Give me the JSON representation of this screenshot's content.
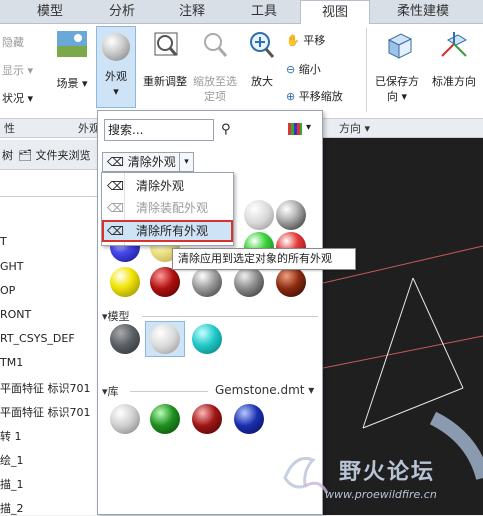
{
  "tabs": [
    "模型",
    "分析",
    "注释",
    "工具",
    "视图",
    "柔性建模"
  ],
  "active_tab": "视图",
  "ribbon": {
    "hide": "隐藏",
    "display": "显示",
    "status": "状况",
    "scene": "场景",
    "appearance": "外观",
    "regen": "重新调整",
    "zoom_selected": "缩放至选定项",
    "zoom_in": "放大",
    "pan": "平移",
    "zoom_out": "缩小",
    "pan_zoom": "平移缩放",
    "saved_orient": "已保存方向",
    "std_orient": "标准方向",
    "group_left": "性",
    "group_appearance": "外观",
    "group_orient": "方向"
  },
  "left_tabs": {
    "tree": "树",
    "browser": "文件夹浏览"
  },
  "tree_items": [
    "T",
    "GHT",
    "OP",
    "RONT",
    "RT_CSYS_DEF",
    "TM1",
    "平面特征 标识701",
    "平面特征 标识701",
    "转 1",
    "绘_1",
    "描_1",
    "描_2"
  ],
  "popup": {
    "search_placeholder": "搜索...",
    "clear_btn": "清除外观",
    "section_model": "模型",
    "section_lib": "库",
    "lib_file": "Gemstone.dmt"
  },
  "menu": {
    "clear": "清除外观",
    "clear_assembly": "清除装配外观",
    "clear_all": "清除所有外观"
  },
  "tooltip": "清除应用到选定对象的所有外观",
  "watermark": {
    "title": "野火论坛",
    "url": "www.proewildfire.cn"
  },
  "colors": {
    "highlight": "#cfe3f7",
    "red_box": "#d9312b"
  }
}
